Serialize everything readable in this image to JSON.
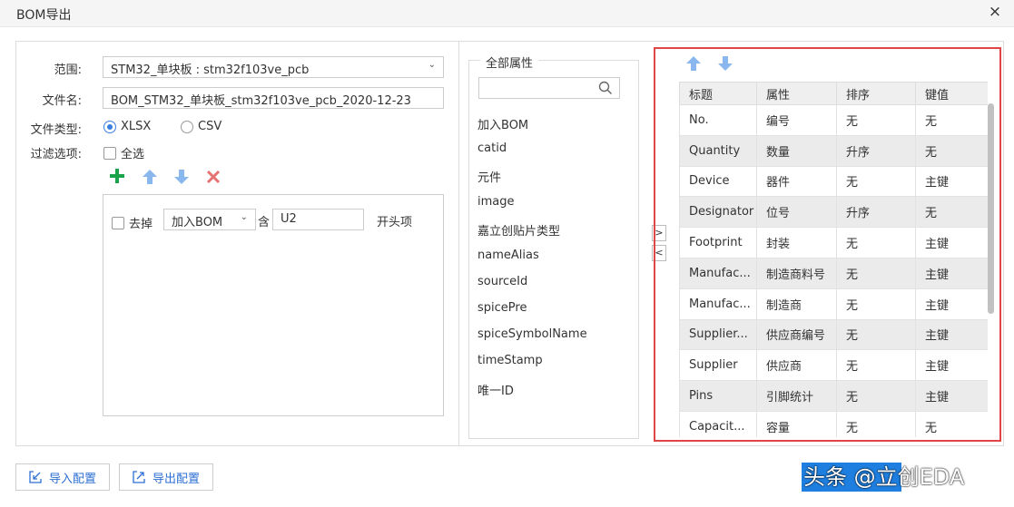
{
  "window": {
    "title": "BOM导出",
    "close_label": "×"
  },
  "form": {
    "scope_label": "范围:",
    "scope_value": "STM32_单块板 : stm32f103ve_pcb",
    "filename_label": "文件名:",
    "filename_value": "BOM_STM32_单块板_stm32f103ve_pcb_2020-12-23",
    "filetype_label": "文件类型:",
    "filetype_options": [
      "XLSX",
      "CSV"
    ],
    "filetype_selected": "XLSX",
    "filter_label": "过滤选项:",
    "select_all_label": "全选"
  },
  "filter_row": {
    "remove_label": "去掉",
    "field_value": "加入BOM",
    "contains_label": "含",
    "text_value": "U2",
    "mode_label": "开头项"
  },
  "attributes": {
    "legend": "全部属性",
    "search_placeholder": "",
    "items": [
      "加入BOM",
      "catid",
      "元件",
      "image",
      "嘉立创贴片类型",
      "nameAlias",
      "sourceId",
      "spicePre",
      "spiceSymbolName",
      "timeStamp",
      "唯一ID"
    ]
  },
  "transfer": {
    "add": ">",
    "remove": "<"
  },
  "table": {
    "headers": [
      "标题",
      "属性",
      "排序",
      "键值"
    ],
    "rows": [
      [
        "No.",
        "编号",
        "无",
        "无"
      ],
      [
        "Quantity",
        "数量",
        "升序",
        "无"
      ],
      [
        "Device",
        "器件",
        "无",
        "主键"
      ],
      [
        "Designator",
        "位号",
        "升序",
        "无"
      ],
      [
        "Footprint",
        "封装",
        "无",
        "主键"
      ],
      [
        "Manufac...",
        "制造商料号",
        "无",
        "主键"
      ],
      [
        "Manufac...",
        "制造商",
        "无",
        "主键"
      ],
      [
        "Supplier...",
        "供应商编号",
        "无",
        "主键"
      ],
      [
        "Supplier",
        "供应商",
        "无",
        "主键"
      ],
      [
        "Pins",
        "引脚统计",
        "无",
        "主键"
      ],
      [
        "Capacit...",
        "容量",
        "无",
        "无"
      ]
    ]
  },
  "footer": {
    "import_label": "导入配置",
    "export_label": "导出配置",
    "watermark": "头条 @立创EDA"
  },
  "colors": {
    "accent": "#2d6fd3",
    "highlight_border": "#e04646",
    "add_green": "#1aa34a",
    "delete_red": "#e57373",
    "arrow_blue": "#8ab8ee"
  }
}
